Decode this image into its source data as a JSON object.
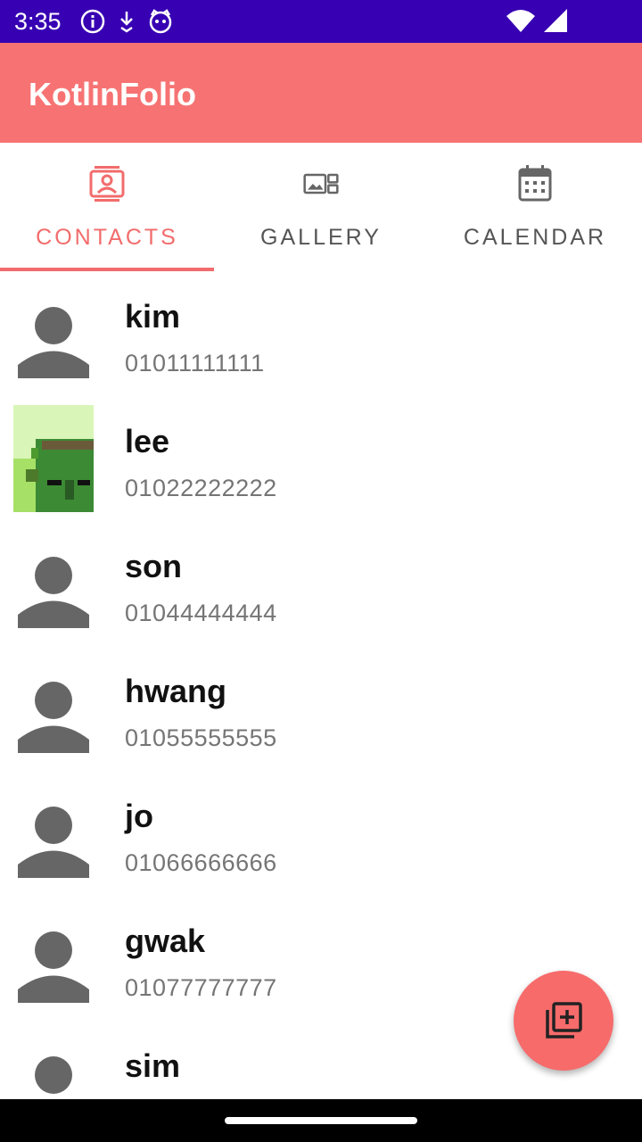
{
  "status_bar": {
    "time": "3:35",
    "icons_left": [
      "info-icon",
      "download-icon",
      "cat-icon"
    ],
    "icons_right": [
      "wifi-icon",
      "signal-icon"
    ]
  },
  "app_bar": {
    "title": "KotlinFolio",
    "color": "#f77373"
  },
  "tabs": [
    {
      "label": "CONTACTS",
      "icon": "contacts-icon",
      "active": true
    },
    {
      "label": "GALLERY",
      "icon": "gallery-icon",
      "active": false
    },
    {
      "label": "CALENDAR",
      "icon": "calendar-icon",
      "active": false
    }
  ],
  "contacts": [
    {
      "name": "kim",
      "phone": "01011111111",
      "avatar": "person-icon"
    },
    {
      "name": "lee",
      "phone": "01022222222",
      "avatar": "pixel-photo"
    },
    {
      "name": "son",
      "phone": "01044444444",
      "avatar": "person-icon"
    },
    {
      "name": "hwang",
      "phone": "01055555555",
      "avatar": "person-icon"
    },
    {
      "name": "jo",
      "phone": "01066666666",
      "avatar": "person-icon"
    },
    {
      "name": "gwak",
      "phone": "01077777777",
      "avatar": "person-icon"
    },
    {
      "name": "sim",
      "phone": "",
      "avatar": "person-icon"
    }
  ],
  "fab": {
    "icon": "add-to-library-icon",
    "color": "#f76b6b"
  },
  "accent_color": "#f26c6c"
}
